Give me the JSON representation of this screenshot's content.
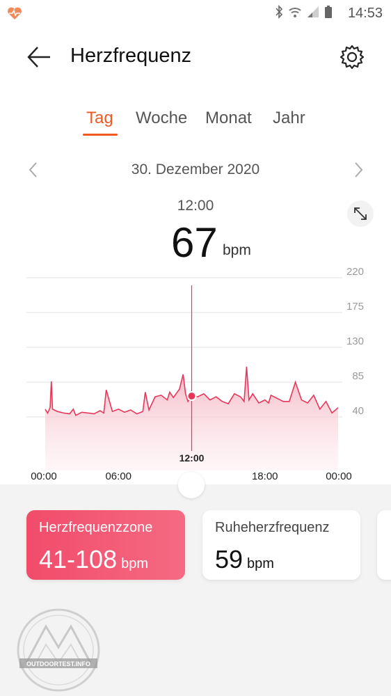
{
  "status_bar": {
    "time": "14:53"
  },
  "header": {
    "title": "Herzfrequenz"
  },
  "tabs": [
    {
      "label": "Tag",
      "active": true
    },
    {
      "label": "Woche",
      "active": false
    },
    {
      "label": "Monat",
      "active": false
    },
    {
      "label": "Jahr",
      "active": false
    }
  ],
  "date_nav": {
    "date": "30. Dezember 2020"
  },
  "selection": {
    "time": "12:00",
    "value": "67",
    "unit": "bpm"
  },
  "chart_data": {
    "type": "area",
    "y_ticks": [
      "220",
      "175",
      "130",
      "85",
      "40"
    ],
    "ylim": [
      40,
      220
    ],
    "x_ticks": [
      "00:00",
      "06:00",
      "12:00",
      "18:00",
      "00:00"
    ],
    "cursor_label": "12:00",
    "cursor_value": 67,
    "color": "#e8365a",
    "series": [
      {
        "x": [
          0,
          0.2,
          0.4,
          0.5,
          0.6,
          1,
          1.5,
          2,
          2.3,
          2.5,
          3,
          3.5,
          4,
          4.5,
          4.8,
          5,
          5.5,
          6,
          6.5,
          7,
          7.5,
          8,
          8.2,
          8.5,
          9,
          9.5,
          10,
          10.2,
          10.5,
          11,
          11.3,
          11.5,
          11.7,
          12,
          12.5,
          13,
          13.5,
          14,
          14.5,
          15,
          15.5,
          16,
          16.3,
          16.5,
          16.7,
          17,
          17.5,
          18,
          18.3,
          18.5,
          19,
          19.5,
          20,
          20.5,
          21,
          21.5,
          22,
          22.5,
          23,
          23.5,
          24
        ],
        "y": [
          50,
          45,
          52,
          86,
          50,
          47,
          45,
          44,
          50,
          42,
          46,
          45,
          44,
          48,
          45,
          75,
          47,
          50,
          46,
          49,
          44,
          47,
          72,
          49,
          66,
          68,
          62,
          72,
          65,
          76,
          95,
          70,
          60,
          67,
          66,
          70,
          62,
          66,
          60,
          57,
          70,
          66,
          60,
          105,
          62,
          70,
          58,
          62,
          58,
          68,
          64,
          60,
          60,
          85,
          62,
          58,
          68,
          50,
          60,
          45,
          52
        ]
      }
    ]
  },
  "cards": {
    "zone": {
      "label": "Herzfrequenzzone",
      "value": "41-108",
      "unit": "bpm"
    },
    "rest": {
      "label": "Ruheherzfrequenz",
      "value": "59",
      "unit": "bpm"
    }
  },
  "watermark": {
    "text": "OUTDOORTEST.INFO"
  }
}
